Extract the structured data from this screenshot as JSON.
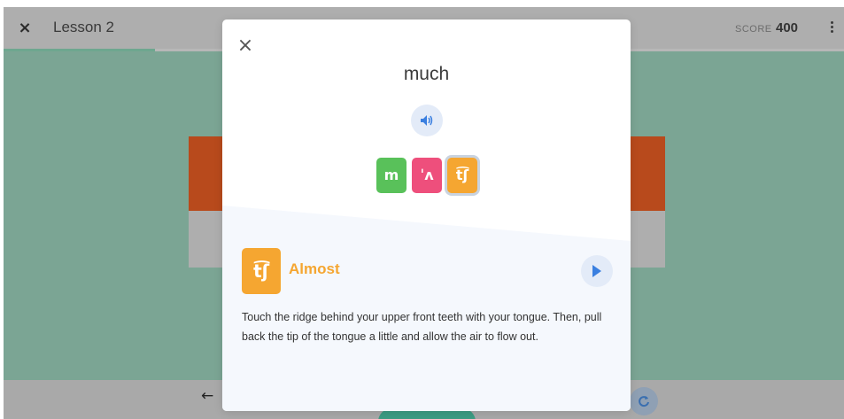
{
  "header": {
    "close_glyph": "×",
    "lesson_title": "Lesson 2",
    "score_label": "SCORE",
    "score_value": "400",
    "more_icon": "more-vertical-icon",
    "progress_fraction": 0.18
  },
  "footer": {
    "back_glyph": "←",
    "refresh_icon": "refresh-icon"
  },
  "modal": {
    "close_glyph": "×",
    "word": "much",
    "speaker_icon": "speaker-icon",
    "phonemes": [
      {
        "symbol": "m",
        "color": "#59c15a"
      },
      {
        "symbol": "ˈʌ",
        "color": "#ee4f7c"
      },
      {
        "symbol": "t͡ʃ",
        "color": "#f5a631"
      }
    ],
    "feedback": {
      "symbol": "t͡ʃ",
      "label": "Almost",
      "play_icon": "play-icon",
      "tip": "Touch the ridge behind your upper front teeth with your tongue. Then, pull back the tip of the tongue a little and allow the air to flow out."
    }
  },
  "colors": {
    "background": "#7ba594",
    "accent_orange": "#f5a631",
    "accent_green": "#59c15a",
    "accent_pink": "#ee4f7c",
    "blue": "#3a7fe0"
  }
}
